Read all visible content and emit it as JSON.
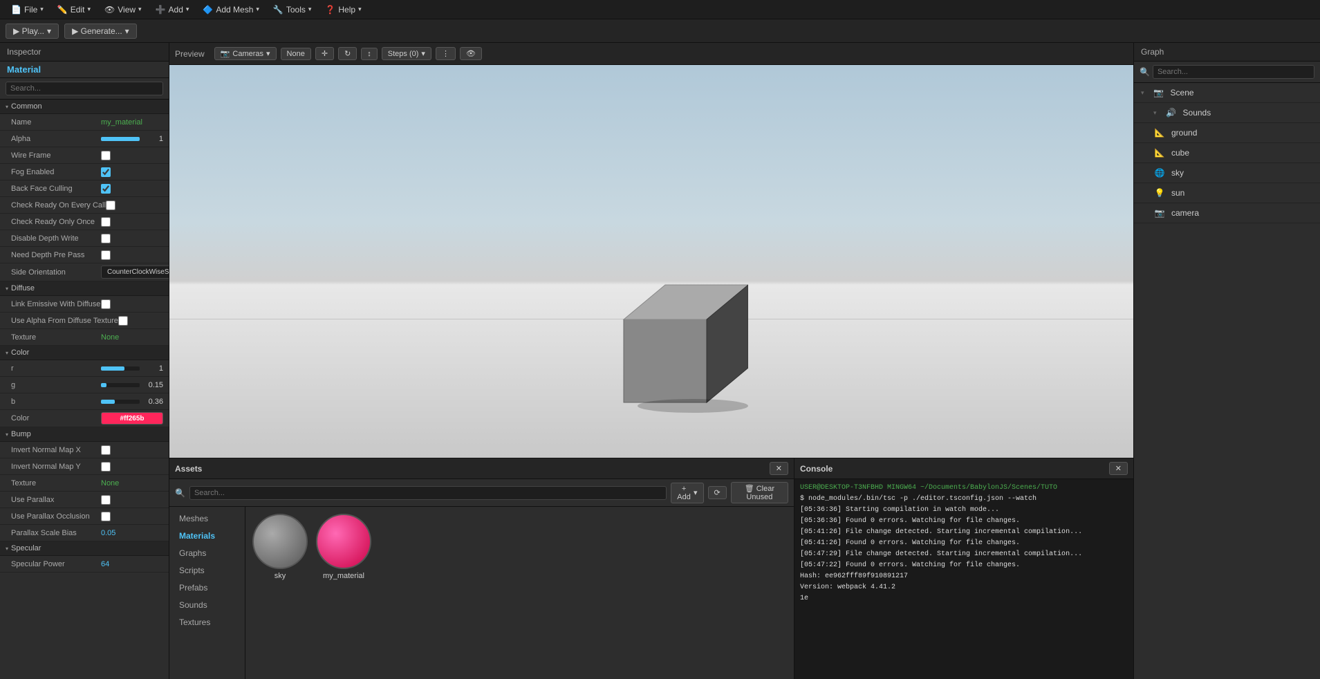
{
  "menubar": {
    "items": [
      {
        "label": "File",
        "icon": "📄"
      },
      {
        "label": "Edit",
        "icon": "✏️"
      },
      {
        "label": "View",
        "icon": "👁"
      },
      {
        "label": "Add",
        "icon": "➕"
      },
      {
        "label": "Add Mesh",
        "icon": "🔷"
      },
      {
        "label": "Tools",
        "icon": "🔧"
      },
      {
        "label": "Help",
        "icon": "❓"
      }
    ]
  },
  "toolbar": {
    "play_label": "▶  Play...",
    "generate_label": "▶  Generate..."
  },
  "inspector": {
    "header": "Inspector",
    "tab": "Material",
    "search_placeholder": "Search...",
    "sections": {
      "common": {
        "label": "Common",
        "props": [
          {
            "name": "Name",
            "value": "my_material",
            "type": "text-green"
          },
          {
            "name": "Alpha",
            "value": "1",
            "type": "slider",
            "fill": 100
          },
          {
            "name": "Wire Frame",
            "value": false,
            "type": "checkbox"
          },
          {
            "name": "Fog Enabled",
            "value": true,
            "type": "checkbox"
          },
          {
            "name": "Back Face Culling",
            "value": true,
            "type": "checkbox"
          },
          {
            "name": "Check Ready On Every Call",
            "value": false,
            "type": "checkbox"
          },
          {
            "name": "Check Ready Only Once",
            "value": false,
            "type": "checkbox"
          },
          {
            "name": "Disable Depth Write",
            "value": false,
            "type": "checkbox"
          },
          {
            "name": "Need Depth Pre Pass",
            "value": false,
            "type": "checkbox"
          },
          {
            "name": "Side Orientation",
            "value": "CounterClockWiseSideOrient",
            "type": "dropdown"
          }
        ]
      },
      "diffuse": {
        "label": "Diffuse",
        "props": [
          {
            "name": "Link Emissive With Diffuse",
            "value": false,
            "type": "checkbox"
          },
          {
            "name": "Use Alpha From Diffuse Texture",
            "value": false,
            "type": "checkbox"
          },
          {
            "name": "Texture",
            "value": "None",
            "type": "text-none"
          }
        ]
      },
      "color": {
        "label": "Color",
        "props": [
          {
            "name": "r",
            "value": "1",
            "type": "slider-r",
            "fill": 60
          },
          {
            "name": "g",
            "value": "0.15",
            "type": "slider-g",
            "fill": 15
          },
          {
            "name": "b",
            "value": "0.36",
            "type": "slider-b",
            "fill": 36
          },
          {
            "name": "Color",
            "value": "#ff265b",
            "type": "color-swatch"
          }
        ]
      },
      "bump": {
        "label": "Bump",
        "props": [
          {
            "name": "Invert Normal Map X",
            "value": false,
            "type": "checkbox"
          },
          {
            "name": "Invert Normal Map Y",
            "value": false,
            "type": "checkbox"
          },
          {
            "name": "Texture",
            "value": "None",
            "type": "text-none"
          },
          {
            "name": "Use Parallax",
            "value": false,
            "type": "checkbox"
          },
          {
            "name": "Use Parallax Occlusion",
            "value": false,
            "type": "checkbox"
          },
          {
            "name": "Parallax Scale Bias",
            "value": "0.05",
            "type": "num-val"
          }
        ]
      },
      "specular": {
        "label": "Specular",
        "props": [
          {
            "name": "Specular Power",
            "value": "64",
            "type": "num-val"
          }
        ]
      }
    }
  },
  "preview": {
    "label": "Preview",
    "cameras_label": "Cameras",
    "none_label": "None",
    "steps_label": "Steps (0)"
  },
  "assets": {
    "label": "Assets",
    "search_placeholder": "Search...",
    "add_label": "+ Add",
    "clear_label": "🗑 Clear Unused",
    "sidebar": [
      {
        "label": "Meshes"
      },
      {
        "label": "Materials",
        "active": true
      },
      {
        "label": "Graphs"
      },
      {
        "label": "Scripts"
      },
      {
        "label": "Prefabs"
      },
      {
        "label": "Sounds"
      },
      {
        "label": "Textures"
      }
    ],
    "items": [
      {
        "name": "sky",
        "type": "sky-ball"
      },
      {
        "name": "my_material",
        "type": "material-ball"
      }
    ]
  },
  "console": {
    "label": "Console",
    "lines": [
      {
        "text": "USER@DESKTOP-T3NFBHD MINGW64 ~/Documents/BabylonJS/Scenes/TUTO",
        "class": "green"
      },
      {
        "text": "$ node_modules/.bin/tsc -p ./editor.tsconfig.json --watch",
        "class": "white"
      },
      {
        "text": "[05:36:36] Starting compilation in watch mode...",
        "class": "white"
      },
      {
        "text": "[05:36:36] Found 0 errors. Watching for file changes.",
        "class": "white"
      },
      {
        "text": "[05:41:26] File change detected. Starting incremental compilation...",
        "class": "white"
      },
      {
        "text": "[05:41:26] Found 0 errors. Watching for file changes.",
        "class": "white"
      },
      {
        "text": "[05:47:29] File change detected. Starting incremental compilation...",
        "class": "white"
      },
      {
        "text": "[05:47:22] Found 0 errors. Watching for file changes.",
        "class": "white"
      },
      {
        "text": "Hash: ee962fff89f910891217",
        "class": "white"
      },
      {
        "text": "Version: webpack 4.41.2",
        "class": "white"
      },
      {
        "text": "1e",
        "class": "white"
      }
    ]
  },
  "graph": {
    "label": "Graph",
    "search_placeholder": "Search...",
    "items": [
      {
        "label": "Scene",
        "icon": "📷",
        "level": 0,
        "expanded": true
      },
      {
        "label": "Sounds",
        "icon": "🔊",
        "level": 1,
        "expanded": true
      },
      {
        "label": "ground",
        "icon": "📐",
        "level": 1
      },
      {
        "label": "cube",
        "icon": "📐",
        "level": 1
      },
      {
        "label": "sky",
        "icon": "🌐",
        "level": 1
      },
      {
        "label": "sun",
        "icon": "💡",
        "level": 1
      },
      {
        "label": "camera",
        "icon": "📷",
        "level": 1
      }
    ]
  }
}
